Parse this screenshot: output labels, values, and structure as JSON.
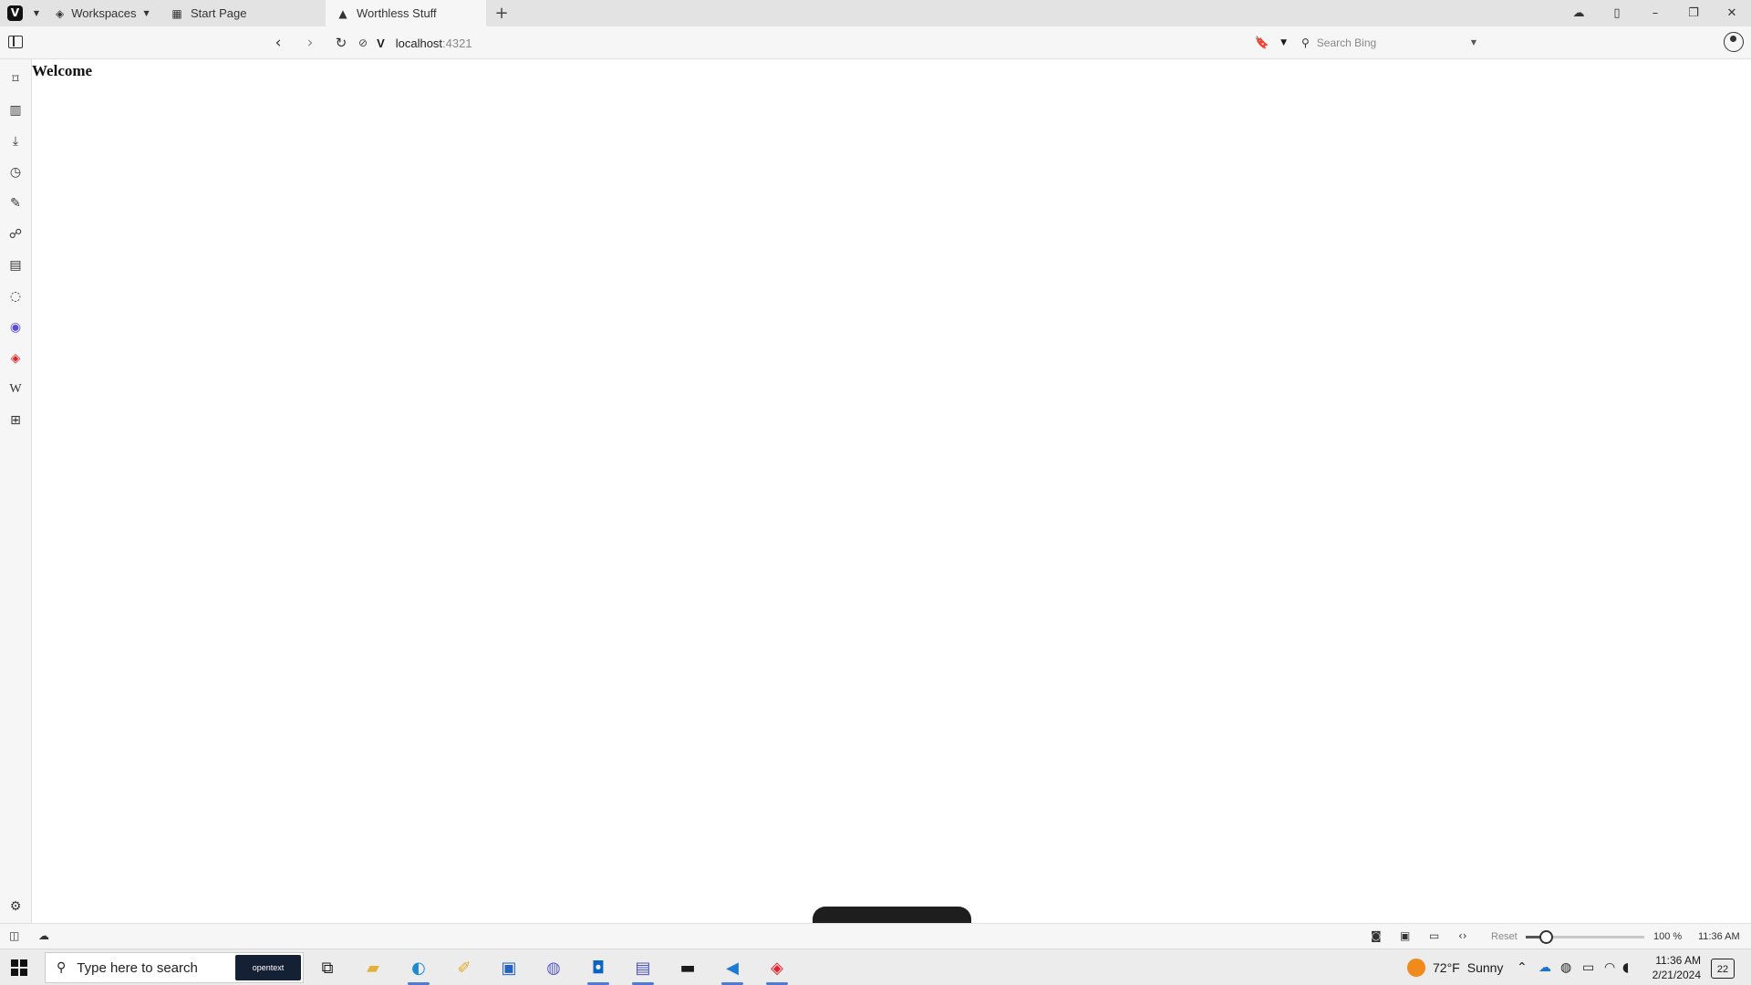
{
  "tabs": {
    "workspaces_label": "Workspaces",
    "start_page_label": "Start Page",
    "active_tab_label": "Worthless Stuff"
  },
  "address": {
    "host": "localhost",
    "port": ":4321",
    "search_placeholder": "Search Bing"
  },
  "page": {
    "heading": "Welcome"
  },
  "statusbar": {
    "reset_label": "Reset",
    "zoom_level": "100 %",
    "zoom_fraction": 0.17,
    "time": "11:36 AM"
  },
  "taskbar": {
    "search_placeholder": "Type here to search",
    "search_brand": "opentext",
    "weather_temp": "72°F",
    "weather_desc": "Sunny",
    "clock_time": "11:36 AM",
    "clock_date": "2/21/2024",
    "notification_count": "22"
  },
  "colors": {
    "accent": "#4a7cd6",
    "vivaldi_red": "#e8202b",
    "mastodon": "#5b4bdb"
  }
}
